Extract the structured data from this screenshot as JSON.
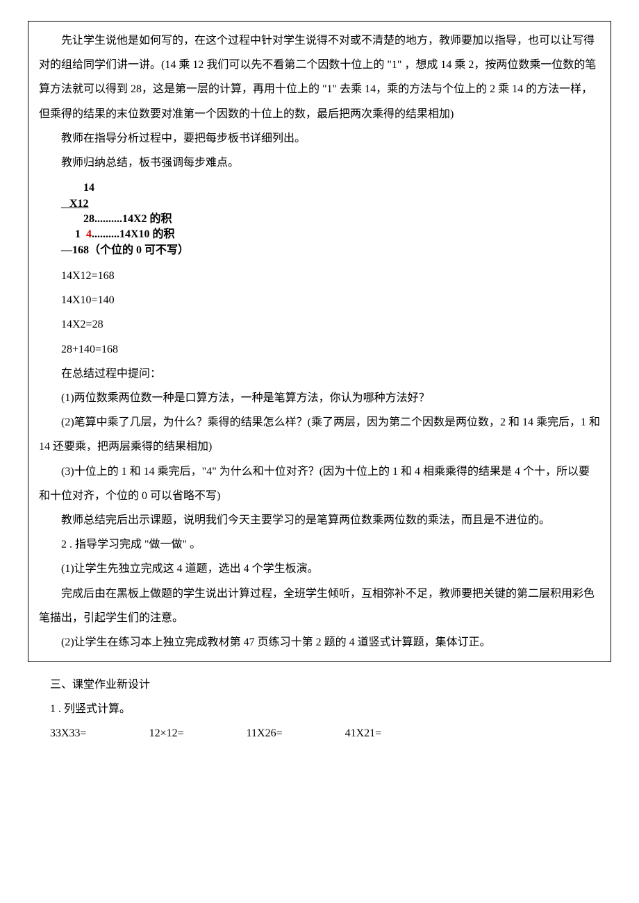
{
  "box": {
    "p1": "先让学生说他是如何写的，在这个过程中针对学生说得不对或不清楚的地方，教师要加以指导，也可以让写得对的组给同学们讲一讲。(14 乘 12 我们可以先不看第二个因数十位上的 \"1\" ，想成 14 乘 2，按两位数乘一位数的笔算方法就可以得到 28，这是第一层的计算，再用十位上的 \"1\" 去乘 14，乘的方法与个位上的 2 乘 14 的方法一样，但乘得的结果的末位数要对准第一个因数的十位上的数，最后把两次乘得的结果相加)",
    "p2": "教师在指导分析过程中，要把每步板书详细列出。",
    "p3": "教师归纳总结，板书强调每步难点。",
    "calc": {
      "l1": "        14",
      "l2a": "   X12",
      "l3": "        28..........14X2 的积",
      "l4_pre": "     1  ",
      "l4_red": "4",
      "l4_post": "..........14X10 的积",
      "l5": "—168（个位的 0 可不写）"
    },
    "eq1": "14X12=168",
    "eq2": "14X10=140",
    "eq3": "14X2=28",
    "eq4": "28+140=168",
    "p4": "在总结过程中提问：",
    "p5": "(1)两位数乘两位数一种是口算方法，一种是笔算方法，你认为哪种方法好？",
    "p6": "(2)笔算中乘了几层，为什么？乘得的结果怎么样？(乘了两层，因为第二个因数是两位数，2 和 14 乘完后，1 和 14 还要乘，把两层乘得的结果相加)",
    "p7": "(3)十位上的 1 和 14 乘完后，\"4\" 为什么和十位对齐？(因为十位上的 1 和 4 相乘乘得的结果是 4 个十，所以要和十位对齐，个位的 0 可以省略不写)",
    "p8": "教师总结完后出示课题，说明我们今天主要学习的是笔算两位数乘两位数的乘法，而且是不进位的。",
    "p9": "2 . 指导学习完成 \"做一做\" 。",
    "p10": "(1)让学生先独立完成这 4 道题，选出 4 个学生板演。",
    "p11": "完成后由在黑板上做题的学生说出计算过程，全班学生倾听，互相弥补不足，教师要把关键的第二层积用彩色笔描出，引起学生们的注意。",
    "p12": "(2)让学生在练习本上独立完成教材第 47 页练习十第 2 题的 4 道竖式计算题，集体订正。"
  },
  "after": {
    "p1": "三、课堂作业新设计",
    "p2": "1 . 列竖式计算。"
  },
  "exercises": {
    "e1": "33X33=",
    "e2": "12×12=",
    "e3": "11X26=",
    "e4": "41X21="
  }
}
